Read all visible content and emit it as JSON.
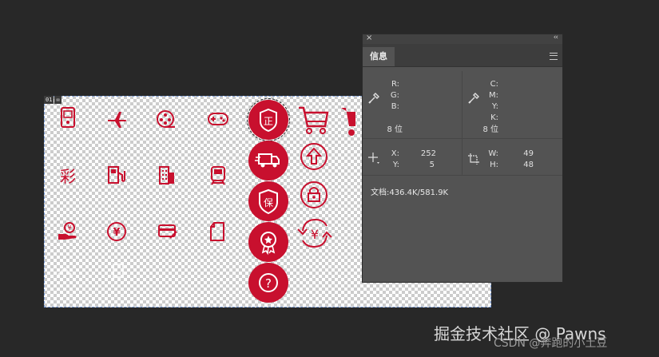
{
  "document": {
    "layer_badge": [
      "01",
      "✉"
    ],
    "icon_color": "#c8102e",
    "icons": [
      "handheld-device-icon",
      "airplane-icon",
      "film-reel-icon",
      "gamepad-icon",
      "lottery-cai-icon",
      "gas-station-icon",
      "building-icon",
      "train-icon",
      "coin-hand-icon",
      "yuan-coin-icon",
      "credit-card-icon",
      "document-icon",
      "zheng-badge-icon",
      "delivery-truck-icon",
      "bao-shield-icon",
      "award-medal-icon",
      "question-icon",
      "shopping-cart-icon",
      "upload-arrow-icon",
      "lock-icon",
      "yuan-exchange-icon"
    ],
    "glyphs": {
      "cai": "彩",
      "zheng": "正",
      "bao": "保",
      "yuan": "¥",
      "question": "?"
    }
  },
  "info_panel": {
    "tab": "信息",
    "rgb_labels": [
      "R:",
      "G:",
      "B:"
    ],
    "rgb_bits": "8 位",
    "cmyk_labels": [
      "C:",
      "M:",
      "Y:",
      "K:"
    ],
    "cmyk_bits": "8 位",
    "x_label": "X:",
    "x_value": "252",
    "y_label": "Y:",
    "y_value": "5",
    "w_label": "W:",
    "w_value": "49",
    "h_label": "H:",
    "h_value": "48",
    "doc_info": "文档:436.4K/581.9K"
  },
  "watermark": {
    "line1": "掘金技术社区 @ Pawns",
    "line2": "CSDN @奔跑的小土豆"
  }
}
